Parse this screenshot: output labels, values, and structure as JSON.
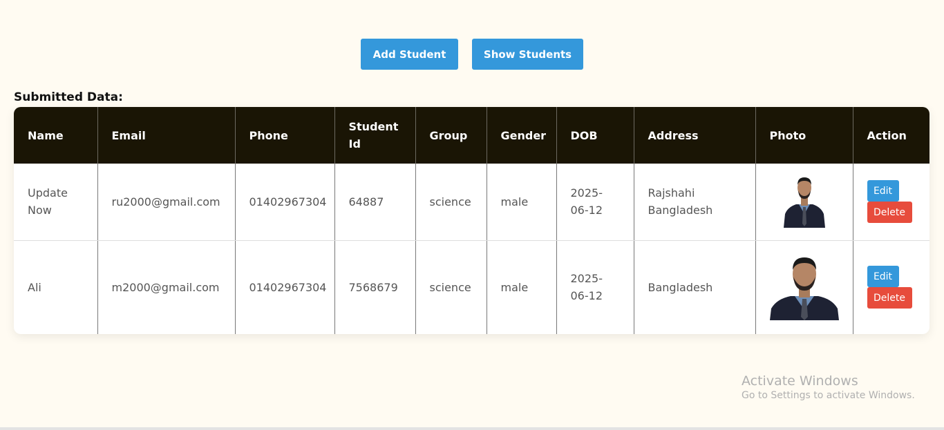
{
  "toolbar": {
    "add_label": "Add Student",
    "show_label": "Show Students"
  },
  "section_title": "Submitted Data:",
  "table": {
    "headers": [
      "Name",
      "Email",
      "Phone",
      "Student Id",
      "Group",
      "Gender",
      "DOB",
      "Address",
      "Photo",
      "Action"
    ],
    "rows": [
      {
        "name": "Update Now",
        "email": "ru2000@gmail.com",
        "phone": "01402967304",
        "student_id": "64887",
        "group": "science",
        "gender": "male",
        "dob": "2025-06-12",
        "address": "Rajshahi Bangladesh",
        "edit": "Edit",
        "delete": "Delete"
      },
      {
        "name": "Ali",
        "email": "m2000@gmail.com",
        "phone": "01402967304",
        "student_id": "7568679",
        "group": "science",
        "gender": "male",
        "dob": "2025-06-12",
        "address": "Bangladesh",
        "edit": "Edit",
        "delete": "Delete"
      }
    ]
  },
  "watermark": {
    "title": "Activate Windows",
    "subtitle": "Go to Settings to activate Windows."
  },
  "colors": {
    "background": "#fffbf2",
    "accent": "#3498db",
    "danger": "#e74c3c",
    "header": "#1a1505"
  }
}
